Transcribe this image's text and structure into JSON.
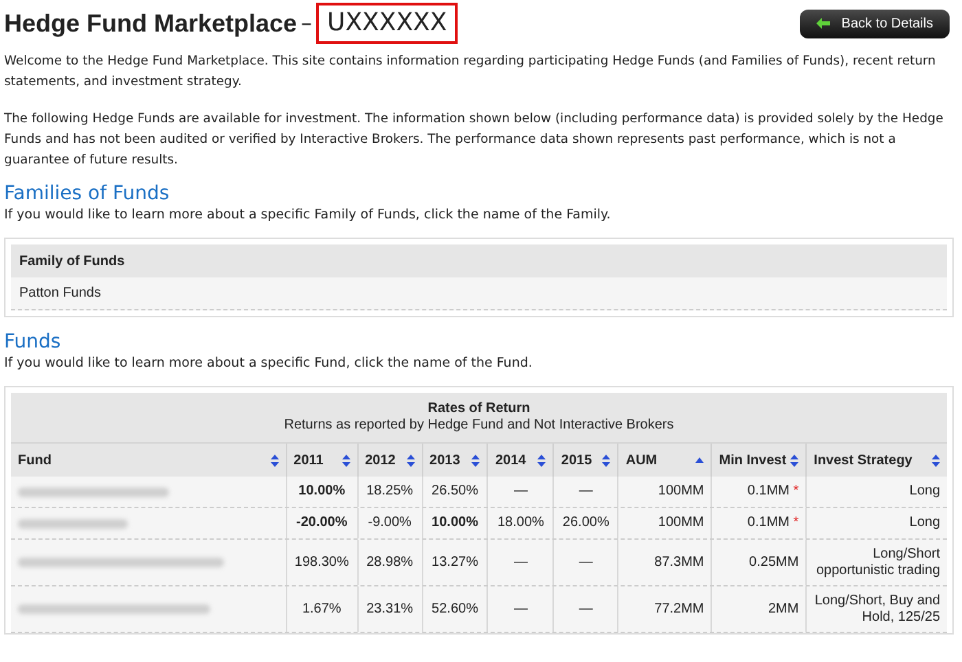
{
  "title": "Hedge Fund Marketplace",
  "title_separator": "–",
  "account": "UXXXXXX",
  "back_button": "Back to Details",
  "intro": "Welcome to the Hedge Fund Marketplace. This site contains information regarding participating Hedge Funds (and Families of Funds), recent return statements, and investment strategy.",
  "disclaimer": "The following Hedge Funds are available for investment. The information shown below (including performance data) is provided solely by the Hedge Funds and has not been audited or verified by Interactive Brokers. The performance data shown represents past performance, which is not a guarantee of future results.",
  "families": {
    "heading": "Families of Funds",
    "hint": "If you would like to learn more about a specific Family of Funds, click the name of the Family.",
    "column": "Family of Funds",
    "rows": [
      "Patton Funds"
    ]
  },
  "funds": {
    "heading": "Funds",
    "hint": "If you would like to learn more about a specific Fund, click the name of the Fund.",
    "group_title": "Rates of Return",
    "group_subtitle": "Returns as reported by Hedge Fund and Not Interactive Brokers",
    "columns": [
      {
        "label": "Fund",
        "sorted": false
      },
      {
        "label": "2011",
        "sorted": false
      },
      {
        "label": "2012",
        "sorted": false
      },
      {
        "label": "2013",
        "sorted": false
      },
      {
        "label": "2014",
        "sorted": false
      },
      {
        "label": "2015",
        "sorted": false
      },
      {
        "label": "AUM",
        "sorted": true
      },
      {
        "label": "Min Invest",
        "sorted": false
      },
      {
        "label": "Invest Strategy",
        "sorted": false
      }
    ],
    "rows": [
      {
        "cells": [
          {
            "kind": "redacted"
          },
          {
            "text": "10.00%",
            "bold": true
          },
          {
            "text": "18.25%",
            "bold": false
          },
          {
            "text": "26.50%",
            "bold": false
          },
          {
            "text": "—",
            "bold": false
          },
          {
            "text": "—",
            "bold": false
          },
          {
            "text": "100MM",
            "bold": false
          },
          {
            "text": "0.1MM",
            "bold": false,
            "note": "*"
          },
          {
            "text": "Long",
            "bold": false
          }
        ]
      },
      {
        "cells": [
          {
            "kind": "redacted"
          },
          {
            "text": "-20.00%",
            "bold": true
          },
          {
            "text": "-9.00%",
            "bold": false
          },
          {
            "text": "10.00%",
            "bold": true
          },
          {
            "text": "18.00%",
            "bold": false
          },
          {
            "text": "26.00%",
            "bold": false
          },
          {
            "text": "100MM",
            "bold": false
          },
          {
            "text": "0.1MM",
            "bold": false,
            "note": "*"
          },
          {
            "text": "Long",
            "bold": false
          }
        ]
      },
      {
        "cells": [
          {
            "kind": "redacted"
          },
          {
            "text": "198.30%",
            "bold": false
          },
          {
            "text": "28.98%",
            "bold": false
          },
          {
            "text": "13.27%",
            "bold": false
          },
          {
            "text": "—",
            "bold": false
          },
          {
            "text": "—",
            "bold": false
          },
          {
            "text": "87.3MM",
            "bold": false
          },
          {
            "text": "0.25MM",
            "bold": false
          },
          {
            "text": "Long/Short opportunistic trading",
            "bold": false
          }
        ]
      },
      {
        "cells": [
          {
            "kind": "redacted"
          },
          {
            "text": "1.67%",
            "bold": false
          },
          {
            "text": "23.31%",
            "bold": false
          },
          {
            "text": "52.60%",
            "bold": false
          },
          {
            "text": "—",
            "bold": false
          },
          {
            "text": "—",
            "bold": false
          },
          {
            "text": "77.2MM",
            "bold": false
          },
          {
            "text": "2MM",
            "bold": false
          },
          {
            "text": "Long/Short, Buy and Hold, 125/25",
            "bold": false
          }
        ]
      }
    ]
  }
}
